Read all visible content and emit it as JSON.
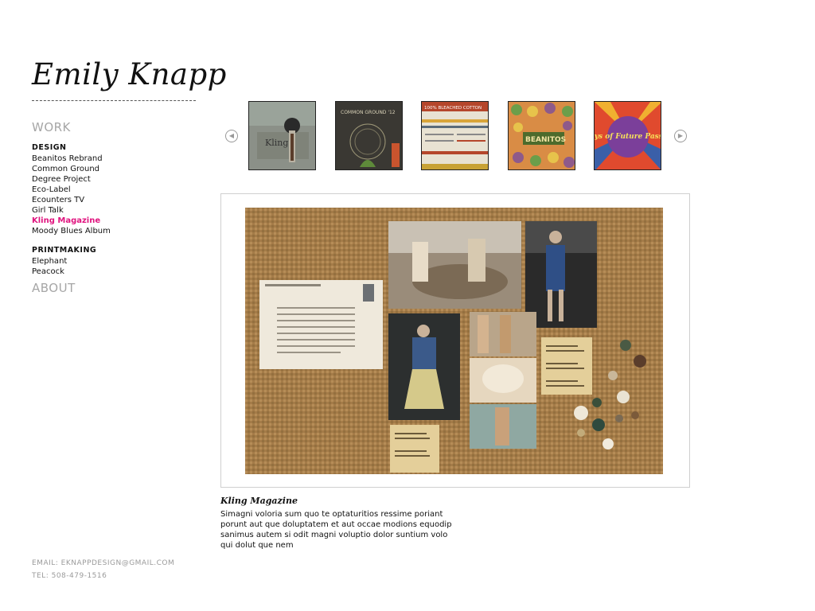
{
  "logo": "Emily Knapp",
  "nav": {
    "work_label": "WORK",
    "design": {
      "heading": "DESIGN",
      "items": [
        {
          "label": "Beanitos Rebrand"
        },
        {
          "label": "Common Ground"
        },
        {
          "label": "Degree Project"
        },
        {
          "label": "Eco-Label"
        },
        {
          "label": "Ecounters TV"
        },
        {
          "label": "Girl Talk"
        },
        {
          "label": "Kling Magazine",
          "active": true
        },
        {
          "label": "Moody Blues Album"
        }
      ]
    },
    "printmaking": {
      "heading": "PRINTMAKING",
      "items": [
        {
          "label": "Elephant"
        },
        {
          "label": "Peacock"
        }
      ]
    },
    "about_label": "ABOUT"
  },
  "contact": {
    "email": "EMAIL: EKNAPPDESIGN@GMAIL.COM",
    "tel": "TEL: 508-479-1516"
  },
  "carousel": {
    "thumbnails": [
      {
        "name": "Kling",
        "text": "Kling"
      },
      {
        "name": "Common Ground",
        "text": "COMMON GROUND '12"
      },
      {
        "name": "Degree Project",
        "text": "100% BLEACHED COTTON"
      },
      {
        "name": "Beanitos",
        "text": "BEANITOS"
      },
      {
        "name": "Moody Blues",
        "text": "Days of Future Passed"
      }
    ]
  },
  "feature": {
    "caption_title": "Kling Magazine",
    "caption_body": "Simagni voloria sum quo te optaturitios ressime poriant porunt aut que doluptatem et aut occae modions equodip sanimus autem si odit magni voluptio dolor suntium volo qui dolut que nem"
  },
  "colors": {
    "accent": "#e0147f",
    "nav_gray": "#a6a6a6",
    "burlap": "#a47b48"
  }
}
